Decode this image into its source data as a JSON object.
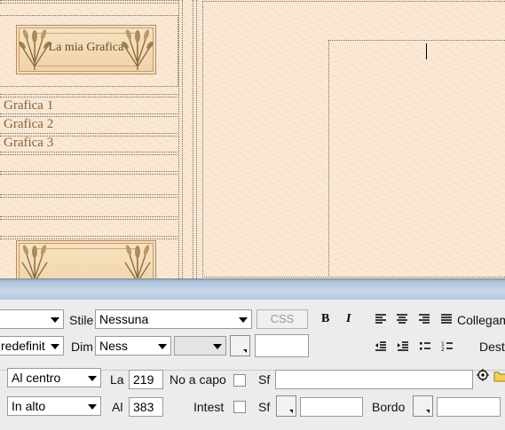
{
  "design": {
    "banner_title": "La mia Grafica",
    "links": [
      "Grafica 1",
      "Grafica 2",
      "Grafica 3"
    ]
  },
  "properties": {
    "format_value": "",
    "style_label": "Stile",
    "style_value": "Nessuna",
    "css_button": "CSS",
    "bold_label": "B",
    "italic_label": "I",
    "link_label": "Collegam",
    "font_value": "redefinit",
    "size_label": "Dim",
    "size_value": "Ness",
    "size_unit_value": "",
    "color_value": "",
    "target_label": "Dest",
    "horz_value": "Al centro",
    "width_label": "La",
    "width_value": "219",
    "nowrap_label": "No a capo",
    "bg_label": "Sf",
    "bg_value": "",
    "vert_value": "In alto",
    "height_label": "Al",
    "height_value": "383",
    "header_label": "Intest",
    "bg_color_label": "Sf",
    "bg_color_value": "",
    "border_label": "Bordo",
    "border_value": ""
  },
  "icons": [
    "align-left-icon",
    "align-center-icon",
    "align-right-icon",
    "justify-icon",
    "outdent-icon",
    "indent-icon",
    "unordered-list-icon",
    "ordered-list-icon",
    "point-to-file-icon",
    "folder-icon"
  ]
}
